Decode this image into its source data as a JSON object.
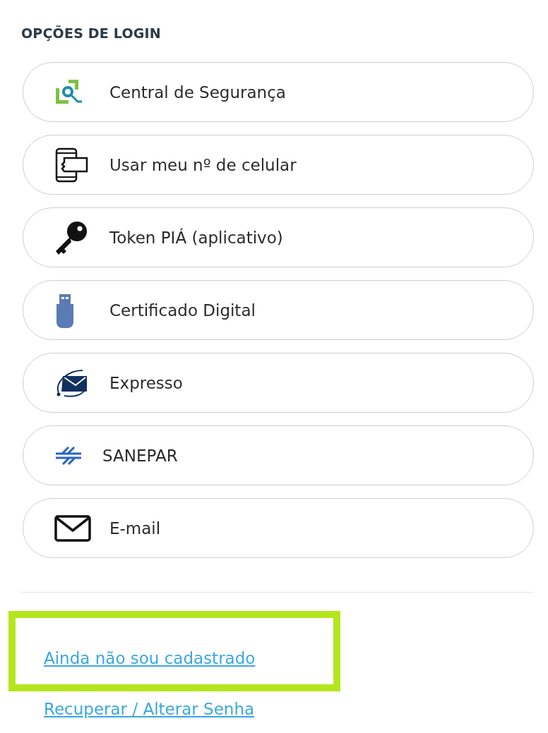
{
  "heading": "OPÇÕES DE LOGIN",
  "options": [
    {
      "kind": "security",
      "label": "Central de Segurança"
    },
    {
      "kind": "phone",
      "label": "Usar meu nº de celular"
    },
    {
      "kind": "key",
      "label": "Token PIÁ (aplicativo)"
    },
    {
      "kind": "usb",
      "label": "Certificado Digital"
    },
    {
      "kind": "expresso",
      "label": "Expresso"
    },
    {
      "kind": "sanepar",
      "label": "SANEPAR"
    },
    {
      "kind": "email",
      "label": "E-mail"
    }
  ],
  "links": [
    {
      "label": "Ainda não sou cadastrado",
      "highlighted": true
    },
    {
      "label": "Recuperar / Alterar Senha",
      "highlighted": false
    }
  ]
}
